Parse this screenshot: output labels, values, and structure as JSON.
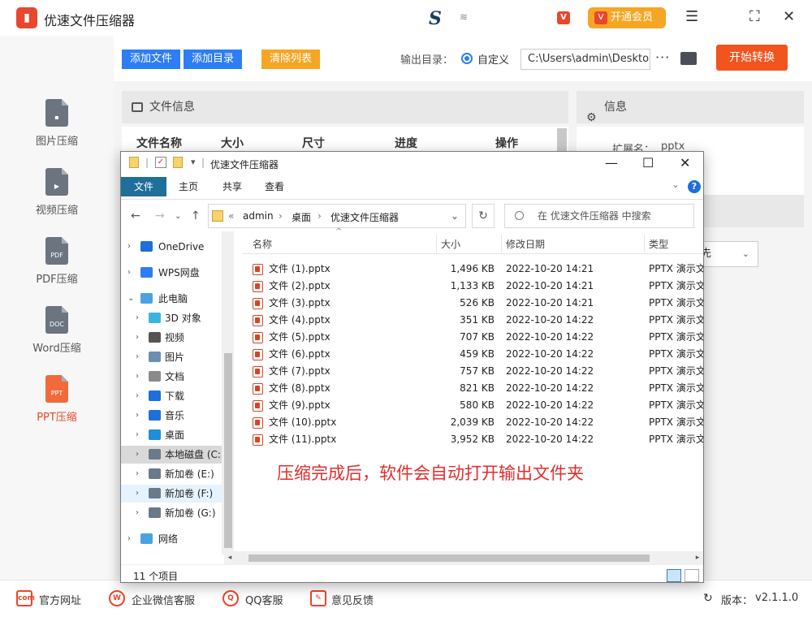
{
  "app": {
    "title": "优速文件压缩器",
    "vip_label": "开通会员",
    "vip_badge": "V",
    "s_logo": "S",
    "version_label": "版本：",
    "version": "v2.1.1.0"
  },
  "sidebar": {
    "items": [
      {
        "label": "图片压缩",
        "icon_tag": ""
      },
      {
        "label": "视频压缩",
        "icon_tag": ""
      },
      {
        "label": "PDF压缩",
        "icon_tag": "PDF"
      },
      {
        "label": "Word压缩",
        "icon_tag": "DOC"
      },
      {
        "label": "PPT压缩",
        "icon_tag": "PPT"
      }
    ]
  },
  "toolbar": {
    "add_file": "添加文件",
    "add_dir": "添加目录",
    "clear_list": "清除列表",
    "output_label": "输出目录：",
    "custom_label": "自定义",
    "output_path": "C:\\Users\\admin\\Desktop",
    "more": "···",
    "start": "开始转换"
  },
  "file_panel": {
    "header": "文件信息",
    "columns": [
      "文件名称",
      "大小",
      "尺寸",
      "进度",
      "操作"
    ]
  },
  "info_panel": {
    "header": "信息",
    "ext_label": "扩展名：",
    "ext_value": "pptx",
    "select_value": "先"
  },
  "explorer": {
    "title": "优速文件压缩器",
    "ribbon_tabs": [
      "文件",
      "主页",
      "共享",
      "查看"
    ],
    "address": [
      "«",
      "admin",
      "›",
      "桌面",
      "›",
      "优速文件压缩器"
    ],
    "search_placeholder": "在 优速文件压缩器 中搜索",
    "tree": [
      {
        "label": "OneDrive",
        "icon": "cloud-icon",
        "color": "#1e6fd9"
      },
      {
        "label": "WPS网盘",
        "icon": "cloud-icon",
        "color": "#2d7df6"
      },
      {
        "label": "此电脑",
        "icon": "computer-icon",
        "color": "#4aa3df"
      },
      {
        "label": "3D 对象",
        "icon": "cube-icon",
        "color": "#3bb4e0"
      },
      {
        "label": "视频",
        "icon": "video-icon",
        "color": "#555555"
      },
      {
        "label": "图片",
        "icon": "picture-icon",
        "color": "#6a8fb0"
      },
      {
        "label": "文档",
        "icon": "document-icon",
        "color": "#8a8a8a"
      },
      {
        "label": "下载",
        "icon": "download-icon",
        "color": "#1e6fd9"
      },
      {
        "label": "音乐",
        "icon": "music-icon",
        "color": "#1e6fd9"
      },
      {
        "label": "桌面",
        "icon": "desktop-icon",
        "color": "#1e8fd9"
      },
      {
        "label": "本地磁盘 (C:)",
        "icon": "drive-icon",
        "color": "#6a7a8a"
      },
      {
        "label": "新加卷 (E:)",
        "icon": "drive-icon",
        "color": "#6a7a8a"
      },
      {
        "label": "新加卷 (F:)",
        "icon": "drive-icon",
        "color": "#6a7a8a"
      },
      {
        "label": "新加卷 (G:)",
        "icon": "drive-icon",
        "color": "#6a7a8a"
      },
      {
        "label": "网络",
        "icon": "network-icon",
        "color": "#4aa3df"
      }
    ],
    "columns": [
      "名称",
      "大小",
      "修改日期",
      "类型"
    ],
    "files": [
      {
        "name": "文件 (1).pptx",
        "size": "1,496 KB",
        "date": "2022-10-20 14:21",
        "type": "PPTX 演示文稿"
      },
      {
        "name": "文件 (2).pptx",
        "size": "1,133 KB",
        "date": "2022-10-20 14:21",
        "type": "PPTX 演示文稿"
      },
      {
        "name": "文件 (3).pptx",
        "size": "526 KB",
        "date": "2022-10-20 14:21",
        "type": "PPTX 演示文稿"
      },
      {
        "name": "文件 (4).pptx",
        "size": "351 KB",
        "date": "2022-10-20 14:22",
        "type": "PPTX 演示文稿"
      },
      {
        "name": "文件 (5).pptx",
        "size": "707 KB",
        "date": "2022-10-20 14:22",
        "type": "PPTX 演示文稿"
      },
      {
        "name": "文件 (6).pptx",
        "size": "459 KB",
        "date": "2022-10-20 14:22",
        "type": "PPTX 演示文稿"
      },
      {
        "name": "文件 (7).pptx",
        "size": "757 KB",
        "date": "2022-10-20 14:22",
        "type": "PPTX 演示文稿"
      },
      {
        "name": "文件 (8).pptx",
        "size": "821 KB",
        "date": "2022-10-20 14:22",
        "type": "PPTX 演示文稿"
      },
      {
        "name": "文件 (9).pptx",
        "size": "580 KB",
        "date": "2022-10-20 14:22",
        "type": "PPTX 演示文稿"
      },
      {
        "name": "文件 (10).pptx",
        "size": "2,039 KB",
        "date": "2022-10-20 14:22",
        "type": "PPTX 演示文稿"
      },
      {
        "name": "文件 (11).pptx",
        "size": "3,952 KB",
        "date": "2022-10-20 14:22",
        "type": "PPTX 演示文稿"
      }
    ],
    "item_count": "11 个项目",
    "annotation": "压缩完成后，软件会自动打开输出文件夹"
  },
  "bottom": {
    "links": [
      "官方网址",
      "企业微信客服",
      "QQ客服",
      "意见反馈"
    ]
  },
  "colors": {
    "accent": "#e8472d",
    "blue_btn": "#2d7df6",
    "orange_btn": "#f5a623",
    "start_btn": "#f2541e",
    "ribbon_active": "#1e6f99"
  }
}
